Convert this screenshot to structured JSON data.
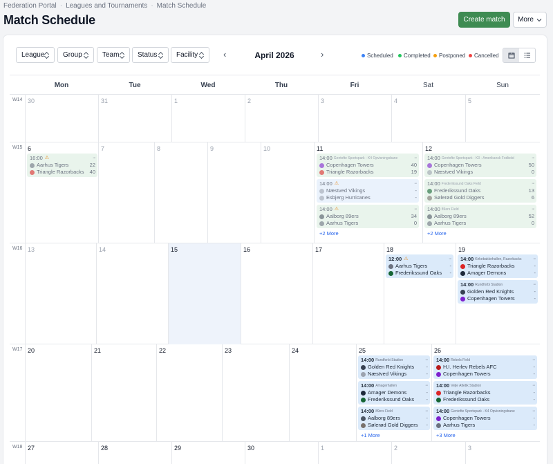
{
  "breadcrumb": [
    "Federation Portal",
    "Leagues and Tournaments",
    "Match Schedule"
  ],
  "breadcrumb_sep": "·",
  "title": "Match Schedule",
  "actions": {
    "create": "Create match",
    "more": "More",
    "more_icon": "chevron-down-icon"
  },
  "filters": [
    "League",
    "Group",
    "Team",
    "Status",
    "Facility"
  ],
  "month": "April 2026",
  "nav": {
    "prev": "‹",
    "next": "›"
  },
  "legend": [
    {
      "label": "Scheduled",
      "color": "#3b82f6"
    },
    {
      "label": "Completed",
      "color": "#22c55e"
    },
    {
      "label": "Postponed",
      "color": "#f59e0b"
    },
    {
      "label": "Cancelled",
      "color": "#ef4444"
    }
  ],
  "view_icons": [
    "calendar-icon",
    "list-icon"
  ],
  "weekdays": [
    "Mon",
    "Tue",
    "Wed",
    "Thu",
    "Fri",
    "Sat",
    "Sun"
  ],
  "weeks": [
    {
      "label": "W14",
      "days": [
        "30",
        "31",
        "1",
        "2",
        "3",
        "4",
        "5"
      ],
      "dim": [
        true,
        true,
        true,
        true,
        true,
        true,
        true
      ]
    },
    {
      "label": "W15",
      "days": [
        "6",
        "7",
        "8",
        "9",
        "10",
        "11",
        "12"
      ],
      "dim": [
        false,
        true,
        true,
        true,
        true,
        false,
        false
      ]
    },
    {
      "label": "W16",
      "days": [
        "13",
        "14",
        "15",
        "16",
        "17",
        "18",
        "19"
      ],
      "dim": [
        true,
        true,
        false,
        false,
        false,
        false,
        false
      ]
    },
    {
      "label": "W17",
      "days": [
        "20",
        "21",
        "22",
        "23",
        "24",
        "25",
        "26"
      ],
      "dim": [
        false,
        false,
        false,
        false,
        false,
        false,
        false
      ]
    },
    {
      "label": "W18",
      "days": [
        "27",
        "28",
        "29",
        "30",
        "1",
        "2",
        "3"
      ],
      "dim": [
        false,
        false,
        false,
        false,
        true,
        true,
        true
      ]
    }
  ],
  "events": {
    "w15_mon": {
      "time": "16:00",
      "venue": "",
      "warn": "⚠",
      "home": "Aarhus Tigers",
      "home_score": "22",
      "away": "Triangle Razorbacks",
      "away_score": "40"
    },
    "w15_fri_1": {
      "time": "14:00",
      "venue": "Gentofte Sportspark - K4 Opvisningsbane",
      "home": "Copenhagen Towers",
      "home_score": "40",
      "away": "Triangle Razorbacks",
      "away_score": "19"
    },
    "w15_fri_2": {
      "time": "14:00",
      "venue": "",
      "warn": "⚠",
      "home": "Næstved Vikings",
      "home_score": "-",
      "away": "Esbjerg Hurricanes",
      "away_score": "-"
    },
    "w15_fri_3": {
      "time": "14:00",
      "venue": "",
      "warn": "⚠",
      "home": "Aalborg 89ers",
      "home_score": "34",
      "away": "Aarhus Tigers",
      "away_score": "0"
    },
    "w15_fri_more": "+2 More",
    "w15_sat_1": {
      "time": "14:00",
      "venue": "Gentofte Sportspark - K3 - Amerikansk Fodbold",
      "home": "Copenhagen Towers",
      "home_score": "50",
      "away": "Næstved Vikings",
      "away_score": "0"
    },
    "w15_sat_2": {
      "time": "14:00",
      "venue": "Frederikssund Oaks Field",
      "home": "Frederikssund Oaks",
      "home_score": "13",
      "away": "Sølerød Gold Diggers",
      "away_score": "6"
    },
    "w15_sat_3": {
      "time": "14:00",
      "venue": "89ers Field",
      "home": "Aalborg 89ers",
      "home_score": "52",
      "away": "Aarhus Tigers",
      "away_score": "0"
    },
    "w15_sat_more": "+2 More",
    "w16_sat": {
      "time": "12:00",
      "venue": "",
      "warn": "⚠",
      "home": "Aarhus Tigers",
      "home_score": "-",
      "away": "Frederikssund Oaks",
      "away_score": "-"
    },
    "w16_sun_1": {
      "time": "14:00",
      "venue": "Kirkebakkehallen, Razorbacks",
      "home": "Triangle Razorbacks",
      "home_score": "-",
      "away": "Amager Demons",
      "away_score": "-"
    },
    "w16_sun_2": {
      "time": "14:00",
      "venue": "Rundforbi Stadion",
      "home": "Golden Red Knights",
      "home_score": "-",
      "away": "Copenhagen Towers",
      "away_score": "-"
    },
    "w17_sat_1": {
      "time": "14:00",
      "venue": "Rundforbi Stadion",
      "home": "Golden Red Knights",
      "home_score": "-",
      "away": "Næstved Vikings",
      "away_score": "-"
    },
    "w17_sat_2": {
      "time": "14:00",
      "venue": "Amagerhallen",
      "home": "Amager Demons",
      "home_score": "-",
      "away": "Frederikssund Oaks",
      "away_score": "-"
    },
    "w17_sat_3": {
      "time": "14:00",
      "venue": "89ers Field",
      "home": "Aalborg 89ers",
      "home_score": "-",
      "away": "Sølerød Gold Diggers",
      "away_score": "-"
    },
    "w17_sat_more": "+1 More",
    "w17_sun_1": {
      "time": "14:00",
      "venue": "Rebels Field",
      "home": "H.I. Herlev Rebels AFC",
      "home_score": "-",
      "away": "Copenhagen Towers",
      "away_score": "-"
    },
    "w17_sun_2": {
      "time": "14:00",
      "venue": "Vejle Atletik Stadion",
      "home": "Triangle Razorbacks",
      "home_score": "-",
      "away": "Frederikssund Oaks",
      "away_score": "-"
    },
    "w17_sun_3": {
      "time": "14:00",
      "venue": "Gentofte Sportspark - K4 Opvisningsbane",
      "home": "Copenhagen Towers",
      "home_score": "-",
      "away": "Aarhus Tigers",
      "away_score": "-"
    },
    "w17_sun_more": "+3 More"
  },
  "menu_dots": "···",
  "team_colors": {
    "Aarhus Tigers": "#6b7280",
    "Triangle Razorbacks": "#dc2626",
    "Copenhagen Towers": "#7e22ce",
    "Næstved Vikings": "#9ca3af",
    "Esbjerg Hurricanes": "#9ca3af",
    "Aalborg 89ers": "#4b5563",
    "Frederikssund Oaks": "#166534",
    "Sølerød Gold Diggers": "#78716c",
    "Amager Demons": "#1e293b",
    "Golden Red Knights": "#374151",
    "H.I. Herlev Rebels AFC": "#b91c1c"
  }
}
